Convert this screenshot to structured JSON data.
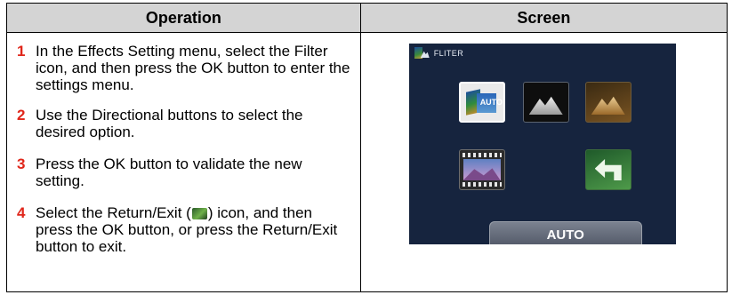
{
  "table": {
    "headers": {
      "operation": "Operation",
      "screen": "Screen"
    },
    "steps": [
      {
        "num": "1",
        "text": "In the Effects Setting menu, select the Filter icon, and then press the OK button to enter the settings menu."
      },
      {
        "num": "2",
        "text": "Use the Directional buttons to select the desired option."
      },
      {
        "num": "3",
        "text": "Press the OK button to validate the new setting."
      },
      {
        "num": "4",
        "text_before": "Select the Return/Exit (",
        "text_after": ") icon, and then press the OK button, or press the Return/Exit button to exit.",
        "inline_icon": "return-exit-icon"
      }
    ]
  },
  "screen": {
    "title": "FLITER",
    "title_icon": "filter-icon",
    "tiles": [
      "auto-filter-tile",
      "black-white-filter-tile",
      "sepia-filter-tile",
      "film-filter-tile",
      "return-tile"
    ],
    "auto_tile_label": "AUTO",
    "selected_label": "AUTO",
    "colors": {
      "background": "#16243e",
      "text": "#ffffff",
      "step_number": "#e0261a",
      "header_bg": "#d4d4d4"
    }
  }
}
